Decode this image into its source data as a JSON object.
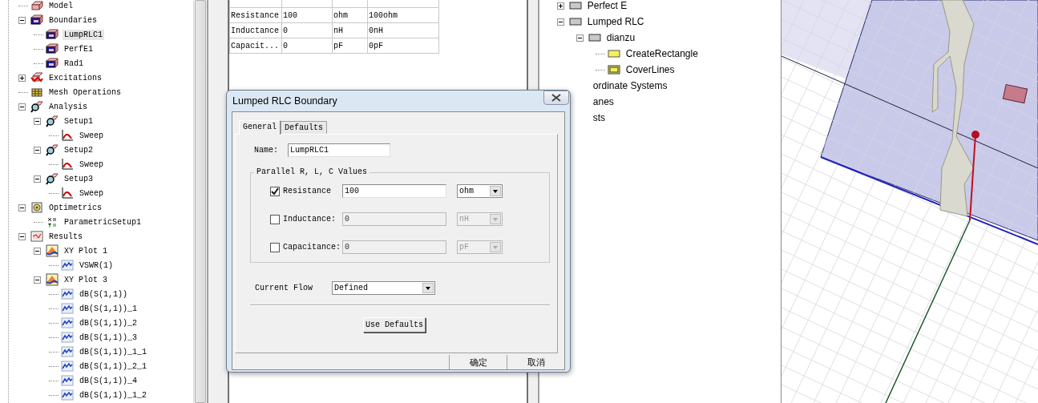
{
  "project_tree": {
    "items": [
      {
        "label": "Model",
        "kind": "model",
        "selected": false
      },
      {
        "label": "Boundaries",
        "kind": "boundary",
        "selected": false,
        "expanded": true,
        "children": [
          {
            "label": "LumpRLC1",
            "kind": "boundary",
            "selected": true
          },
          {
            "label": "PerfE1",
            "kind": "boundary",
            "selected": false
          },
          {
            "label": "Rad1",
            "kind": "boundary",
            "selected": false
          }
        ]
      },
      {
        "label": "Excitations",
        "kind": "excitation",
        "selected": false,
        "expanded": false
      },
      {
        "label": "Mesh Operations",
        "kind": "mesh",
        "selected": false
      },
      {
        "label": "Analysis",
        "kind": "analysis",
        "selected": false,
        "expanded": true,
        "children": [
          {
            "label": "Setup1",
            "kind": "analysis",
            "selected": false,
            "expanded": true,
            "children": [
              {
                "label": "Sweep",
                "kind": "sweep",
                "selected": false
              }
            ]
          },
          {
            "label": "Setup2",
            "kind": "analysis",
            "selected": false,
            "expanded": true,
            "children": [
              {
                "label": "Sweep",
                "kind": "sweep",
                "selected": false
              }
            ]
          },
          {
            "label": "Setup3",
            "kind": "analysis",
            "selected": false,
            "expanded": true,
            "children": [
              {
                "label": "Sweep",
                "kind": "sweep",
                "selected": false
              }
            ]
          }
        ]
      },
      {
        "label": "Optimetrics",
        "kind": "optimetrics",
        "selected": false,
        "expanded": true,
        "children": [
          {
            "label": "ParametricSetup1",
            "kind": "parametric",
            "selected": false
          }
        ]
      },
      {
        "label": "Results",
        "kind": "results",
        "selected": false,
        "expanded": true,
        "children": [
          {
            "label": "XY Plot 1",
            "kind": "plot",
            "selected": false,
            "expanded": true,
            "children": [
              {
                "label": "VSWR(1)",
                "kind": "trace",
                "selected": false
              }
            ]
          },
          {
            "label": "XY Plot 3",
            "kind": "plot",
            "selected": false,
            "expanded": true,
            "children": [
              {
                "label": "dB(S(1,1))",
                "kind": "trace",
                "selected": false
              },
              {
                "label": "dB(S(1,1))_1",
                "kind": "trace",
                "selected": false
              },
              {
                "label": "dB(S(1,1))_2",
                "kind": "trace",
                "selected": false
              },
              {
                "label": "dB(S(1,1))_3",
                "kind": "trace",
                "selected": false
              },
              {
                "label": "dB(S(1,1))_1_1",
                "kind": "trace",
                "selected": false
              },
              {
                "label": "dB(S(1,1))_2_1",
                "kind": "trace",
                "selected": false
              },
              {
                "label": "dB(S(1,1))_4",
                "kind": "trace",
                "selected": false
              },
              {
                "label": "dB(S(1,1))_1_2",
                "kind": "trace",
                "selected": false
              }
            ]
          }
        ]
      }
    ]
  },
  "properties_table": {
    "rows": [
      {
        "name": "Resistance",
        "value": "100",
        "unit": "ohm",
        "evaluated": "100ohm"
      },
      {
        "name": "Inductance",
        "value": "0",
        "unit": "nH",
        "evaluated": "0nH"
      },
      {
        "name": "Capacit...",
        "value": "0",
        "unit": "pF",
        "evaluated": "0pF"
      }
    ]
  },
  "model_tree": {
    "items": [
      {
        "label": "Perfect E",
        "kind": "folder",
        "expanded": false
      },
      {
        "label": "Lumped RLC",
        "kind": "folder",
        "expanded": true,
        "children": [
          {
            "label": "dianzu",
            "kind": "folder",
            "expanded": true,
            "children": [
              {
                "label": "CreateRectangle",
                "kind": "operation"
              },
              {
                "label": "CoverLines",
                "kind": "cover"
              }
            ]
          }
        ]
      },
      {
        "label": "ordinate Systems",
        "kind": "clipped"
      },
      {
        "label": "anes",
        "kind": "clipped"
      },
      {
        "label": "sts",
        "kind": "clipped"
      }
    ]
  },
  "dialog": {
    "title": "Lumped RLC Boundary",
    "tabs": [
      {
        "label": "General",
        "selected": true
      },
      {
        "label": "Defaults",
        "selected": false
      }
    ],
    "name_label": "Name:",
    "name_value": "LumpRLC1",
    "group_title": "Parallel R, L, C Values",
    "parameters": [
      {
        "label": "Resistance",
        "checked": true,
        "value": "100",
        "unit": "ohm"
      },
      {
        "label": "Inductance:",
        "checked": false,
        "value": "0",
        "unit": "nH"
      },
      {
        "label": "Capacitance:",
        "checked": false,
        "value": "0",
        "unit": "pF"
      }
    ],
    "current_flow": {
      "label": "Current Flow",
      "value": "Defined"
    },
    "use_defaults_button": "Use Defaults",
    "buttons": [
      "确定",
      "取消"
    ]
  }
}
